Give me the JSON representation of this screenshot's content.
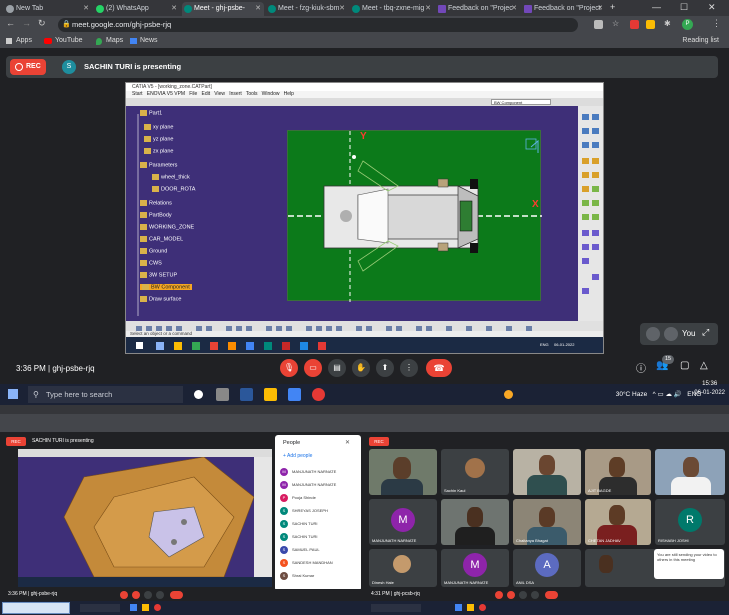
{
  "browser": {
    "tabs": [
      {
        "label": "New Tab",
        "color": "#9aa0a6"
      },
      {
        "label": "(2) WhatsApp",
        "color": "#25d366"
      },
      {
        "label": "Meet - ghj-psbe-",
        "color": "#00897b"
      },
      {
        "label": "Meet - fzg-kiuk-sbm",
        "color": "#00897b"
      },
      {
        "label": "Meet - tbq-zxne-mig",
        "color": "#00897b"
      },
      {
        "label": "Feedback on \"Projec",
        "color": "#7248b9"
      },
      {
        "label": "Feedback on \"Project",
        "color": "#7248b9"
      }
    ],
    "url": "meet.google.com/ghj-psbe-rjq",
    "bookmarks": [
      "Apps",
      "YouTube",
      "Maps",
      "News"
    ],
    "reading_list": "Reading list"
  },
  "meet": {
    "rec_label": "REC",
    "presenter_initial": "S",
    "presenter_text": "SACHIN TURI is presenting",
    "time_code": "3:36 PM | ghj-psbe-rjq",
    "you_label": "You",
    "participants_badge": "15"
  },
  "catia": {
    "title": "CATIA V5 - [working_zone.CATPart]",
    "menu": [
      "Start",
      "ENOVIA V5 VPM",
      "File",
      "Edit",
      "View",
      "Insert",
      "Tools",
      "Window",
      "Help"
    ],
    "tree": [
      "Part1",
      "xy plane",
      "yz plane",
      "zx plane",
      "Parameters",
      "wheel_thick",
      "DOOR_ROTA",
      "Relations",
      "PartBody",
      "WORKING_ZONE",
      "CAR_MODEL",
      "Ground",
      "CWS",
      "3W SETUP",
      "BW Component",
      "Draw surface"
    ],
    "axis_y": "Y",
    "axis_x": "X",
    "status": "Select an object or a command",
    "dropdown": "BW Component",
    "taskbar_lang": "ENG",
    "taskbar_date": "06-01-2022"
  },
  "windows": {
    "search_placeholder": "Type here to search",
    "weather": "30°C Haze",
    "lang": "ENG",
    "clock_time": "15:36",
    "clock_date": "06-01-2022"
  },
  "lower_left": {
    "presenter_text": "SACHIN TURI is presenting",
    "people_title": "People",
    "add_people": "Add people",
    "people": [
      {
        "name": "MANJUNATH NARNATE",
        "color": "#8e24aa",
        "initial": "M"
      },
      {
        "name": "MANJUNATH NARNATE",
        "color": "#8e24aa",
        "initial": "M"
      },
      {
        "name": "Pooja Shinde",
        "color": "#d81b60",
        "initial": "P"
      },
      {
        "name": "SHREYAS JOSEPH",
        "color": "#00897b",
        "initial": "S"
      },
      {
        "name": "SACHIN TURI",
        "color": "#00897b",
        "initial": "S"
      },
      {
        "name": "SACHIN TURI",
        "color": "#00897b",
        "initial": "S"
      },
      {
        "name": "SAMUEL PAUL",
        "color": "#3949ab",
        "initial": "S"
      },
      {
        "name": "SANDESH MANDHAN",
        "color": "#f4511e",
        "initial": "S"
      },
      {
        "name": "Shrai Kumar",
        "color": "#6d4c41",
        "initial": "S"
      }
    ],
    "meet_time": "3:36 PM | ghj-psbe-rjq"
  },
  "lower_right": {
    "meet_time": "4:31 PM | ghj-pcsb-rjq",
    "tiles": [
      {
        "name": "",
        "initial": "",
        "color": ""
      },
      {
        "name": "Sachin Kaul",
        "initial": "",
        "color": ""
      },
      {
        "name": "",
        "initial": "",
        "color": ""
      },
      {
        "name": "AJIT BAGDE",
        "initial": "",
        "color": ""
      },
      {
        "name": "",
        "initial": "",
        "color": ""
      },
      {
        "name": "MANJUNATH NARNATE",
        "initial": "M",
        "color": "#8e24aa"
      },
      {
        "name": "",
        "initial": "",
        "color": ""
      },
      {
        "name": "Chaitanya Bhagat",
        "initial": "",
        "color": ""
      },
      {
        "name": "CHETAN JADHAV",
        "initial": "",
        "color": ""
      },
      {
        "name": "RISHABH JOSHI",
        "initial": "R",
        "color": "#00796b"
      },
      {
        "name": "Dinesh Hale",
        "initial": "",
        "color": ""
      },
      {
        "name": "MANJUNATH NARNATE",
        "initial": "M",
        "color": "#8e24aa"
      },
      {
        "name": "ANIL DSA",
        "initial": "A",
        "color": "#5c6bc0"
      },
      {
        "name": "",
        "initial": "",
        "color": ""
      }
    ],
    "toast": "You are still sending your video to others in this meeting"
  }
}
